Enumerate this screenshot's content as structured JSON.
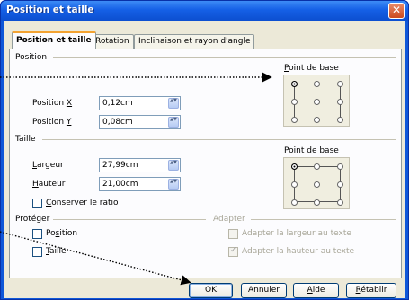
{
  "window": {
    "title": "Position et taille",
    "close_glyph": "✕"
  },
  "tabs": [
    {
      "label": "Position et taille",
      "active": true
    },
    {
      "label": "Rotation",
      "active": false
    },
    {
      "label": "Inclinaison et rayon d'angle",
      "active": false
    }
  ],
  "position": {
    "section_title": "Position",
    "x_label_pre": "Position ",
    "x_label_key": "X",
    "x_value": "0,12cm",
    "y_label_pre": "Position ",
    "y_label_key": "Y",
    "y_value": "0,08cm",
    "basepoint_label_pre": "",
    "basepoint_label_key": "P",
    "basepoint_label_post": "oint de base",
    "basepoint_selected": "top-left"
  },
  "taille": {
    "section_title": "Taille",
    "width_label_key": "L",
    "width_label_post": "argeur",
    "width_value": "27,99cm",
    "height_label_key": "H",
    "height_label_post": "auteur",
    "height_value": "21,00cm",
    "ratio_label_key": "C",
    "ratio_label_post": "onserver le ratio",
    "ratio_checked": false,
    "basepoint_label_pre": "Point ",
    "basepoint_label_key": "d",
    "basepoint_label_post": "e base",
    "basepoint_selected": "top-left"
  },
  "proteger": {
    "section_title": "Protéger",
    "position_label_pre": "Po",
    "position_label_key": "s",
    "position_label_post": "ition",
    "position_checked": false,
    "size_label_key": "T",
    "size_label_post": "aille",
    "size_checked": false
  },
  "adapter": {
    "section_title": "Adapter",
    "width_fit_label": "Adapter la largeur au texte",
    "width_fit_checked": false,
    "height_fit_label": "Adapter la hauteur au texte",
    "height_fit_checked": true
  },
  "buttons": {
    "ok": "OK",
    "cancel": "Annuler",
    "help_key": "A",
    "help_post": "ide",
    "reset_key": "R",
    "reset_post": "établir"
  },
  "spin_arrows": "▲▼",
  "checkmark": "✓"
}
